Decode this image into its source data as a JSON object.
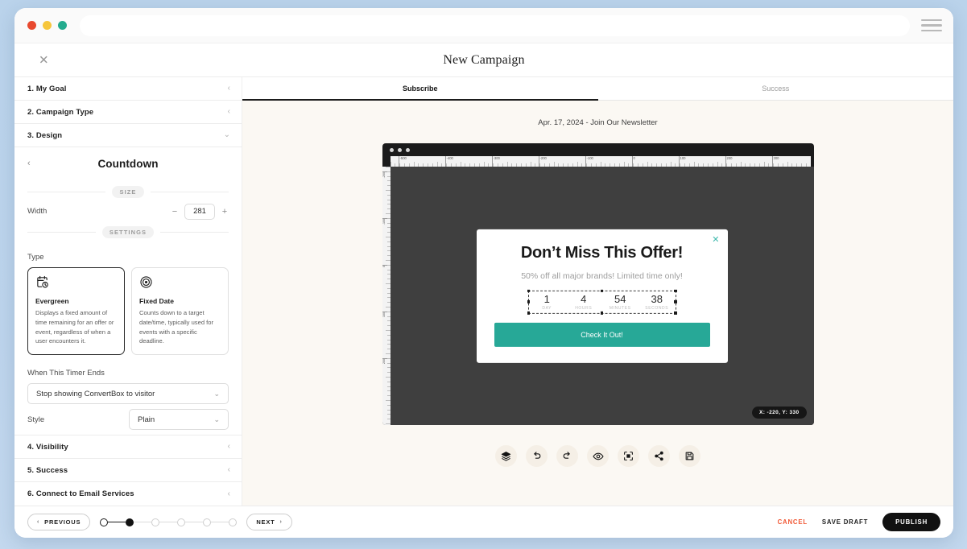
{
  "browser": {
    "traffic_lights": [
      "close-red",
      "minimize-yellow",
      "maximize-green"
    ],
    "menu_icon": "hamburger-icon",
    "url_value": "",
    "url_placeholder": ""
  },
  "header": {
    "close_label": "✕",
    "title": "New Campaign"
  },
  "sidebar": {
    "accordions_top": [
      {
        "label": "1. My Goal",
        "chevron": "‹"
      },
      {
        "label": "2. Campaign Type",
        "chevron": "‹"
      },
      {
        "label": "3. Design",
        "chevron": "⌄"
      }
    ],
    "panel": {
      "back": "‹",
      "title": "Countdown",
      "size_chip": "SIZE",
      "width_label": "Width",
      "width_value": "281",
      "minus": "−",
      "plus": "+",
      "settings_chip": "SETTINGS",
      "type_label": "Type",
      "type_options": [
        {
          "icon": "calendar-clock-icon",
          "title": "Evergreen",
          "desc": "Displays a fixed amount of time remaining for an offer or event, regardless of when a user encounters it.",
          "selected": true
        },
        {
          "icon": "target-icon",
          "title": "Fixed Date",
          "desc": "Counts down to a target date/time, typically used for events with a specific deadline.",
          "selected": false
        }
      ],
      "timer_ends_label": "When This Timer Ends",
      "timer_ends_value": "Stop showing ConvertBox to visitor",
      "style_label": "Style",
      "style_value": "Plain"
    },
    "accordions_bottom": [
      {
        "label": "4. Visibility",
        "chevron": "‹"
      },
      {
        "label": "5. Success",
        "chevron": "‹"
      },
      {
        "label": "6. Connect to Email Services",
        "chevron": "‹"
      }
    ]
  },
  "main": {
    "tabs": [
      {
        "label": "Subscribe",
        "active": true
      },
      {
        "label": "Success",
        "active": false
      }
    ],
    "preview_meta": "Apr. 17, 2024 - Join Our Newsletter",
    "ruler_ticks_h": [
      "-500",
      "-400",
      "-300",
      "-200",
      "-100",
      "0",
      "100",
      "200",
      "300"
    ],
    "ruler_ticks_v": [
      "-200",
      "-100",
      "0",
      "100",
      "200"
    ],
    "coord_badge": "X: -220, Y: 330",
    "popup": {
      "close": "✕",
      "headline": "Don’t Miss This Offer!",
      "subheadline": "50% off all major brands! Limited time only!",
      "countdown": [
        {
          "value": "1",
          "label": "DAY"
        },
        {
          "value": "4",
          "label": "HOURS"
        },
        {
          "value": "54",
          "label": "MINUTES"
        },
        {
          "value": "38",
          "label": "SECONDS"
        }
      ],
      "cta_label": "Check It Out!",
      "cta_color": "#27a897",
      "close_color": "#3fb9ad"
    },
    "toolbar": [
      "layers-icon",
      "undo-icon",
      "redo-icon",
      "eye-preview-icon",
      "fit-to-screen-icon",
      "share-icon",
      "save-icon"
    ]
  },
  "footer": {
    "previous_label": "PREVIOUS",
    "previous_arrow": "‹",
    "next_label": "NEXT",
    "next_arrow": "›",
    "steps": [
      {
        "state": "done"
      },
      {
        "state": "current"
      },
      {
        "state": "todo"
      },
      {
        "state": "todo"
      },
      {
        "state": "todo"
      },
      {
        "state": "todo"
      }
    ],
    "cancel_label": "CANCEL",
    "cancel_color": "#f15a37",
    "save_draft_label": "SAVE DRAFT",
    "publish_label": "PUBLISH"
  }
}
